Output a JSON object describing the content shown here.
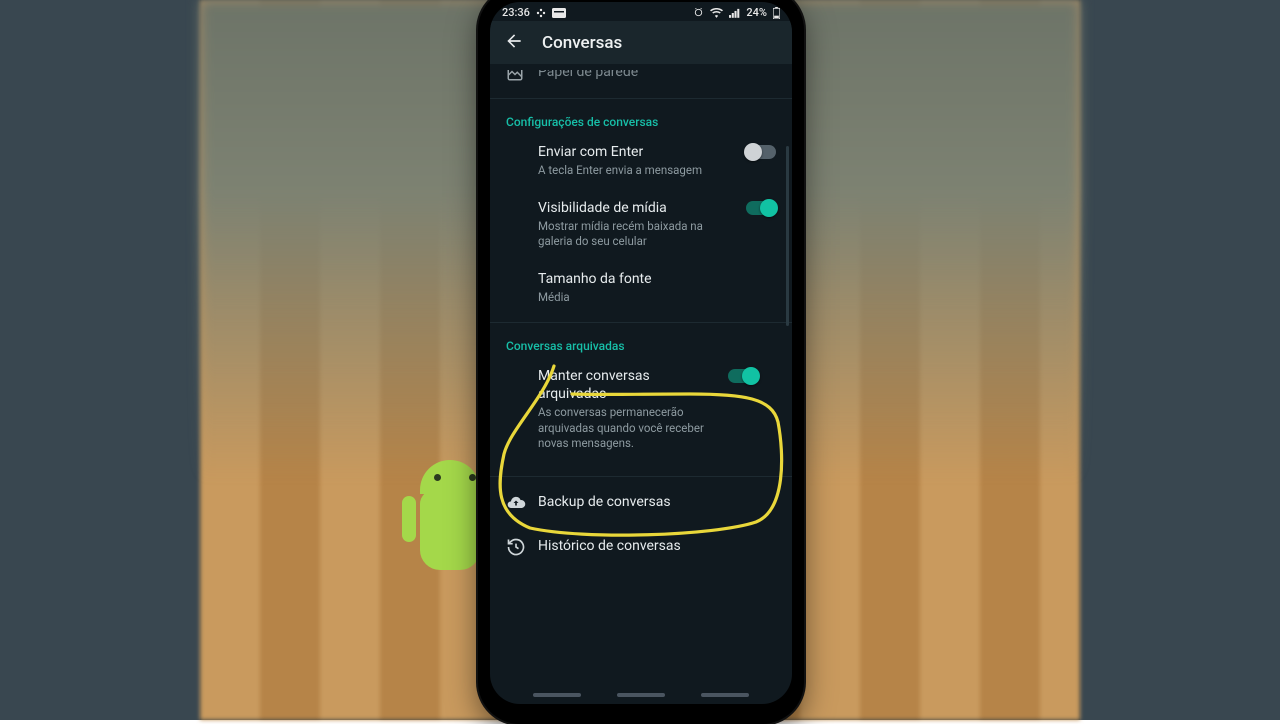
{
  "statusbar": {
    "time": "23:36",
    "battery_pct": "24%"
  },
  "appbar": {
    "title": "Conversas"
  },
  "rows": {
    "wallpaper": {
      "title": "Papel de parede"
    },
    "section_chat": "Configurações de conversas",
    "enter": {
      "title": "Enviar com Enter",
      "sub": "A tecla Enter envia a mensagem"
    },
    "media": {
      "title": "Visibilidade de mídia",
      "sub": "Mostrar mídia recém baixada na galeria do seu celular"
    },
    "font": {
      "title": "Tamanho da fonte",
      "sub": "Média"
    },
    "section_arch": "Conversas arquivadas",
    "keep_arch": {
      "title": "Manter conversas arquivadas",
      "sub": "As conversas permanecerão arquivadas quando você receber novas mensagens."
    },
    "backup": {
      "title": "Backup de conversas"
    },
    "history": {
      "title": "Histórico de conversas"
    }
  },
  "colors": {
    "accent": "#11c2a3",
    "highlight": "#e9d73a"
  }
}
